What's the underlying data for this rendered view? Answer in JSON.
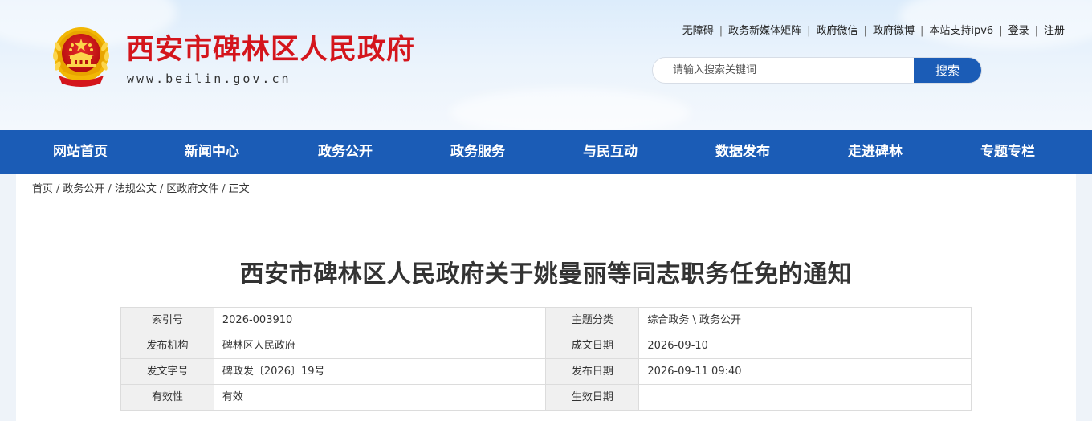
{
  "header": {
    "site_title": "西安市碑林区人民政府",
    "site_domain": "www.beilin.gov.cn",
    "top_links": [
      "无障碍",
      "政务新媒体矩阵",
      "政府微信",
      "政府微博",
      "本站支持ipv6",
      "登录",
      "注册"
    ],
    "search": {
      "placeholder": "请输入搜索关键词",
      "button_label": "搜索"
    }
  },
  "nav": {
    "items": [
      "网站首页",
      "新闻中心",
      "政务公开",
      "政务服务",
      "与民互动",
      "数据发布",
      "走进碑林",
      "专题专栏"
    ]
  },
  "breadcrumb": [
    "首页",
    "政务公开",
    "法规公文",
    "区政府文件",
    "正文"
  ],
  "article": {
    "title": "西安市碑林区人民政府关于姚曼丽等同志职务任免的通知"
  },
  "meta_table": {
    "rows": [
      [
        "索引号",
        "2026-003910",
        "主题分类",
        "综合政务 \\ 政务公开"
      ],
      [
        "发布机构",
        "碑林区人民政府",
        "成文日期",
        "2026-09-10"
      ],
      [
        "发文字号",
        "碑政发〔2026〕19号",
        "发布日期",
        "2026-09-11 09:40"
      ],
      [
        "有效性",
        "有效",
        "生效日期",
        ""
      ]
    ]
  },
  "colors": {
    "title_red": "#d4151c",
    "nav_blue": "#1b5cb6",
    "emblem_gold": "#f5c518"
  },
  "icons": {
    "logo": "national-emblem-icon"
  }
}
